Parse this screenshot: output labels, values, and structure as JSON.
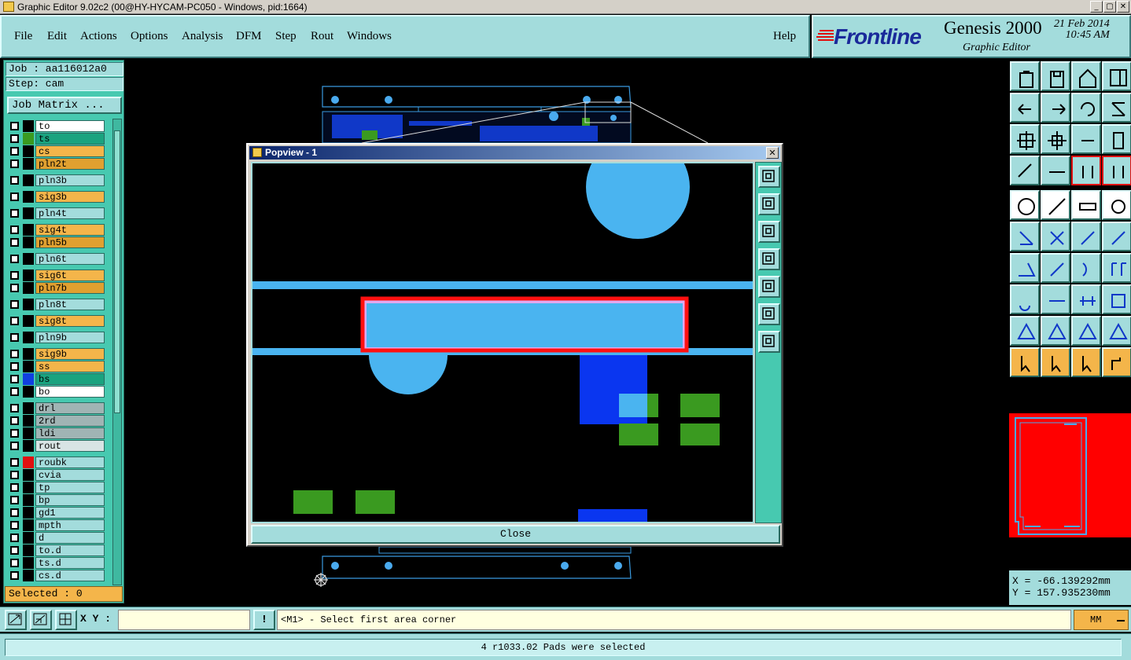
{
  "window": {
    "title": "Graphic Editor 9.02c2 (00@HY-HYCAM-PC050 - Windows, pid:1664)",
    "min": "_",
    "max": "▢",
    "close": "✕"
  },
  "menu": {
    "items": [
      "File",
      "Edit",
      "Actions",
      "Options",
      "Analysis",
      "DFM",
      "Step",
      "Rout",
      "Windows"
    ],
    "help": "Help"
  },
  "brand": {
    "logo": "Frontline",
    "product": "Genesis 2000",
    "subtitle": "Graphic Editor",
    "date": "21 Feb 2014",
    "time": "10:45 AM"
  },
  "job": {
    "job_label": "Job : aa116012a0",
    "step_label": "Step: cam",
    "matrix_button": "Job Matrix ..."
  },
  "layers": [
    {
      "name": "to",
      "color": "#ffffff",
      "swatch": "#000000"
    },
    {
      "name": "ts",
      "color": "#1aa37f",
      "swatch": "#3a9a20"
    },
    {
      "name": "cs",
      "color": "#f4b54a",
      "swatch": "#000000"
    },
    {
      "name": "pln2t",
      "color": "#e0a030",
      "swatch": "#000000"
    },
    {
      "name": "pln3b",
      "color": "#a3dcdc",
      "swatch": "#000000"
    },
    {
      "name": "sig3b",
      "color": "#f4b54a",
      "swatch": "#000000"
    },
    {
      "name": "pln4t",
      "color": "#a3dcdc",
      "swatch": "#000000"
    },
    {
      "name": "sig4t",
      "color": "#f4b54a",
      "swatch": "#000000"
    },
    {
      "name": "pln5b",
      "color": "#e0a030",
      "swatch": "#000000"
    },
    {
      "name": "pln6t",
      "color": "#a3dcdc",
      "swatch": "#000000"
    },
    {
      "name": "sig6t",
      "color": "#f4b54a",
      "swatch": "#000000"
    },
    {
      "name": "pln7b",
      "color": "#e0a030",
      "swatch": "#000000"
    },
    {
      "name": "pln8t",
      "color": "#a3dcdc",
      "swatch": "#000000"
    },
    {
      "name": "sig8t",
      "color": "#f4b54a",
      "swatch": "#000000"
    },
    {
      "name": "pln9b",
      "color": "#a3dcdc",
      "swatch": "#000000"
    },
    {
      "name": "sig9b",
      "color": "#f4b54a",
      "swatch": "#000000"
    },
    {
      "name": "ss",
      "color": "#f4b54a",
      "swatch": "#000000"
    },
    {
      "name": "bs",
      "color": "#1aa37f",
      "swatch": "#1040e0"
    },
    {
      "name": "bo",
      "color": "#ffffff",
      "swatch": "#000000"
    },
    {
      "name": "drl",
      "color": "#a0b4b4",
      "swatch": "#000000"
    },
    {
      "name": "2rd",
      "color": "#a0b4b4",
      "swatch": "#000000"
    },
    {
      "name": "ldi",
      "color": "#a0b4b4",
      "swatch": "#000000"
    },
    {
      "name": "rout",
      "color": "#d8e4e4",
      "swatch": "#000000"
    },
    {
      "name": "roubk",
      "color": "#a3dcdc",
      "swatch": "#e01010"
    },
    {
      "name": "cvia",
      "color": "#a3dcdc",
      "swatch": "#000000"
    },
    {
      "name": "tp",
      "color": "#a3dcdc",
      "swatch": "#000000"
    },
    {
      "name": "bp",
      "color": "#a3dcdc",
      "swatch": "#000000"
    },
    {
      "name": "gd1",
      "color": "#a3dcdc",
      "swatch": "#000000"
    },
    {
      "name": "mpth",
      "color": "#a3dcdc",
      "swatch": "#000000"
    },
    {
      "name": "d",
      "color": "#a3dcdc",
      "swatch": "#000000"
    },
    {
      "name": "to.d",
      "color": "#a3dcdc",
      "swatch": "#000000"
    },
    {
      "name": "ts.d",
      "color": "#a3dcdc",
      "swatch": "#000000"
    },
    {
      "name": "cs.d",
      "color": "#a3dcdc",
      "swatch": "#000000"
    }
  ],
  "selected": "Selected : 0",
  "popview": {
    "title": "Popview - 1",
    "close_button": "Close",
    "close_x": "✕"
  },
  "coords": {
    "x": "X = -66.139292mm",
    "y": "Y = 157.935230mm"
  },
  "bottom": {
    "xy_label": "X Y :",
    "xy_value": "",
    "prompt": "<M1> - Select first area corner",
    "units": "MM",
    "warn": "!"
  },
  "status": "4 r1033.02 Pads were selected"
}
